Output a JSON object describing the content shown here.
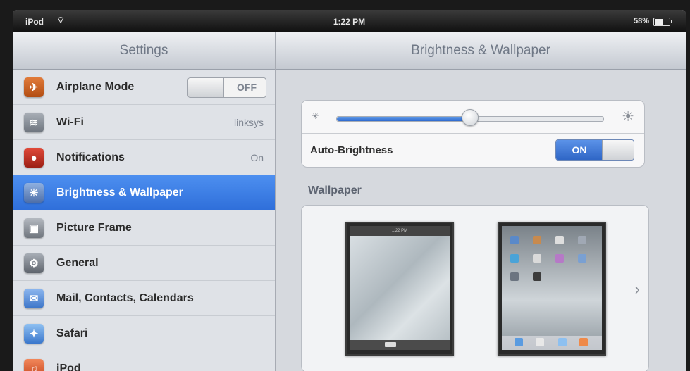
{
  "status_bar": {
    "carrier": "iPod",
    "time": "1:22 PM",
    "battery": "58%",
    "battery_level": 0.58,
    "wifi_icon": "wifi-icon"
  },
  "sidebar": {
    "title": "Settings",
    "items": [
      {
        "label": "Airplane Mode",
        "value": "OFF",
        "icon": "airplane-icon",
        "color": "#c9601f"
      },
      {
        "label": "Wi-Fi",
        "value": "linksys",
        "icon": "wifi-icon",
        "color": "#8c939c"
      },
      {
        "label": "Notifications",
        "value": "On",
        "icon": "notifications-icon",
        "color": "#c0392b"
      },
      {
        "label": "Brightness & Wallpaper",
        "value": "",
        "icon": "brightness-icon",
        "color": "#6b88b8"
      },
      {
        "label": "Picture Frame",
        "value": "",
        "icon": "picture-frame-icon",
        "color": "#8a8f96"
      },
      {
        "label": "General",
        "value": "",
        "icon": "gear-icon",
        "color": "#7c8188"
      },
      {
        "label": "Mail, Contacts, Calendars",
        "value": "",
        "icon": "mail-icon",
        "color": "#5b8fd6"
      },
      {
        "label": "Safari",
        "value": "",
        "icon": "safari-icon",
        "color": "#4c8ad6"
      },
      {
        "label": "iPod",
        "value": "",
        "icon": "ipod-icon",
        "color": "#e0643c"
      }
    ],
    "selected": "Brightness & Wallpaper"
  },
  "detail": {
    "title": "Brightness & Wallpaper",
    "brightness_level": 0.5,
    "auto_brightness_label": "Auto-Brightness",
    "auto_brightness_value": "ON",
    "wallpaper_label": "Wallpaper",
    "lock_screen_time": "1:22 PM"
  },
  "colors": {
    "selected_row": "#2f6fda",
    "toggle_on": "#2f66c6"
  }
}
